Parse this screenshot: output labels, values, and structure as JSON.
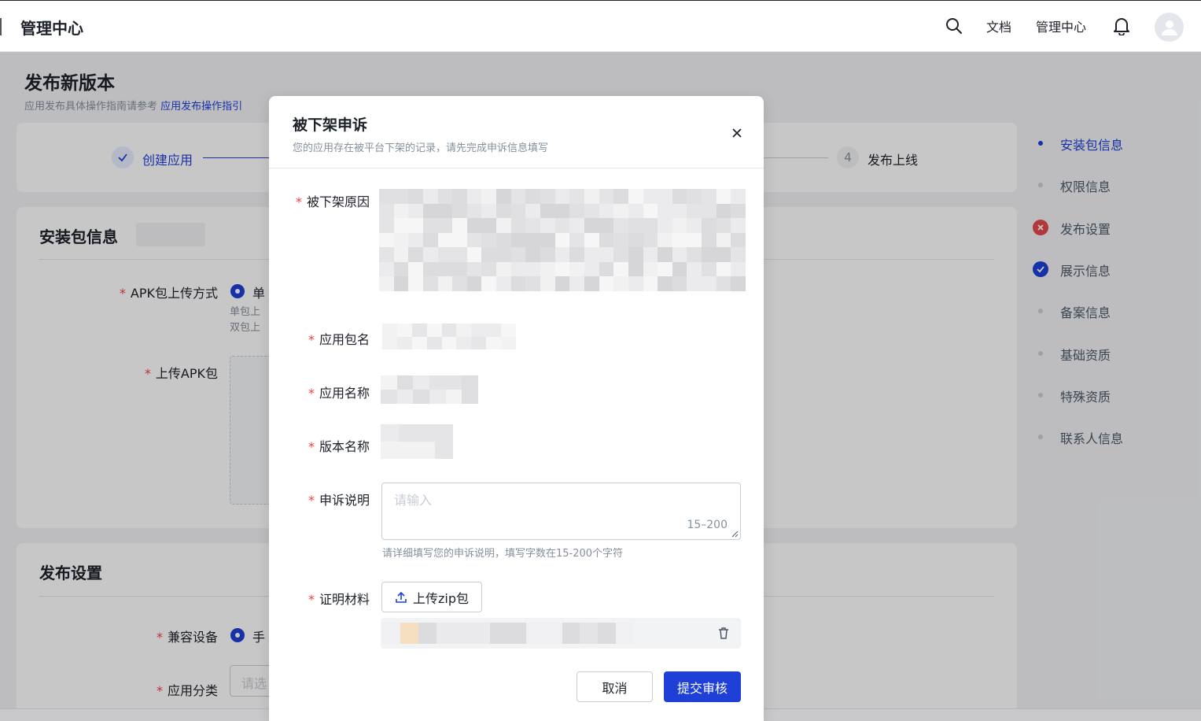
{
  "topbar": {
    "title": "管理中心",
    "nav_docs": "文档",
    "nav_admin": "管理中心"
  },
  "page": {
    "title": "发布新版本",
    "subtitle_prefix": "应用发布具体操作指南请参考",
    "subtitle_link": "应用发布操作指引"
  },
  "steps": {
    "step1_label": "创建应用",
    "step4_number": "4",
    "step4_label": "发布上线"
  },
  "package_section": {
    "title": "安装包信息",
    "upload_mode_label": "APK包上传方式",
    "upload_mode_value": "单",
    "hint_line1": "单包上",
    "hint_line2": "双包上",
    "upload_apk_label": "上传APK包"
  },
  "publish_section": {
    "title": "发布设置",
    "devices_label": "兼容设备",
    "devices_value": "手",
    "category_label": "应用分类",
    "category_placeholder": "请选"
  },
  "anchors": [
    {
      "label": "安装包信息",
      "state": "active"
    },
    {
      "label": "权限信息",
      "state": "normal"
    },
    {
      "label": "发布设置",
      "state": "error"
    },
    {
      "label": "展示信息",
      "state": "done"
    },
    {
      "label": "备案信息",
      "state": "normal"
    },
    {
      "label": "基础资质",
      "state": "normal"
    },
    {
      "label": "特殊资质",
      "state": "normal"
    },
    {
      "label": "联系人信息",
      "state": "normal"
    }
  ],
  "modal": {
    "title": "被下架申诉",
    "subtitle": "您的应用存在被平台下架的记录，请先完成申诉信息填写",
    "reason_label": "被下架原因",
    "package_name_label": "应用包名",
    "app_name_label": "应用名称",
    "version_name_label": "版本名称",
    "appeal_label": "申诉说明",
    "appeal_placeholder": "请输入",
    "appeal_counter": "15–200",
    "appeal_hint": "请详细填写您的申诉说明，填写字数在15-200个字符",
    "proof_label": "证明材料",
    "upload_button": "上传zip包",
    "cancel_button": "取消",
    "submit_button": "提交审核"
  },
  "colors": {
    "primary": "#1e40d6",
    "error": "#e5484d",
    "required": "#f53f3f"
  }
}
